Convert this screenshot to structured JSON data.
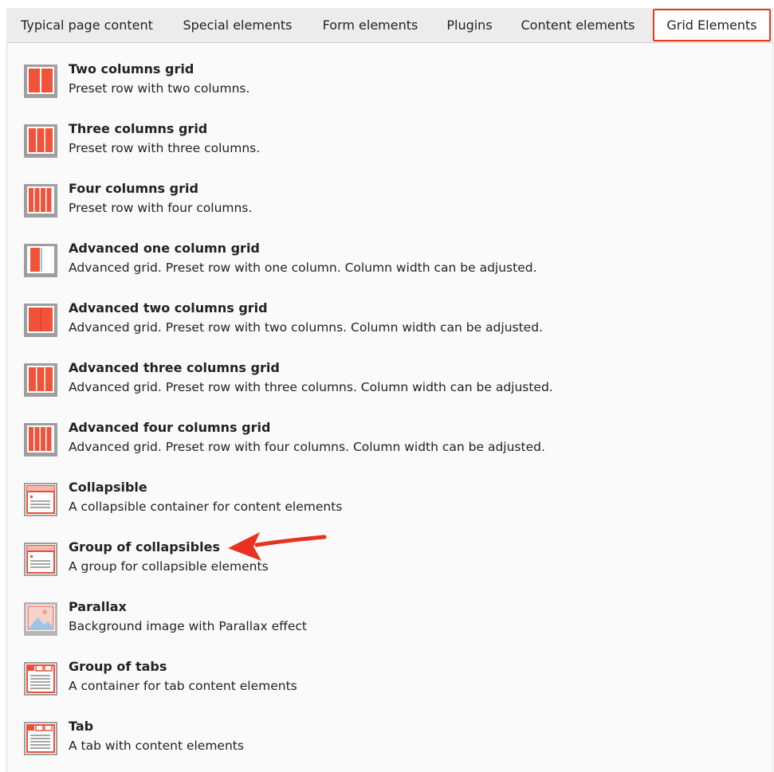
{
  "tabs": [
    {
      "label": "Typical page content"
    },
    {
      "label": "Special elements"
    },
    {
      "label": "Form elements"
    },
    {
      "label": "Plugins"
    },
    {
      "label": "Content elements"
    },
    {
      "label": "Grid Elements"
    }
  ],
  "active_tab": "Grid Elements",
  "colors": {
    "accent": "#e33b23",
    "icon_red": "#f0533a",
    "icon_frame": "#9e9e9e"
  },
  "items": [
    {
      "title": "Two columns grid",
      "description": "Preset row with two columns.",
      "icon": "two-columns-icon"
    },
    {
      "title": "Three columns grid",
      "description": "Preset row with three columns.",
      "icon": "three-columns-icon"
    },
    {
      "title": "Four columns grid",
      "description": "Preset row with four columns.",
      "icon": "four-columns-icon"
    },
    {
      "title": "Advanced one column grid",
      "description": "Advanced grid. Preset row with one column. Column width can be adjusted.",
      "icon": "advanced-one-column-icon"
    },
    {
      "title": "Advanced two columns grid",
      "description": "Advanced grid. Preset row with two columns. Column width can be adjusted.",
      "icon": "advanced-two-columns-icon"
    },
    {
      "title": "Advanced three columns grid",
      "description": "Advanced grid. Preset row with three columns. Column width can be adjusted.",
      "icon": "advanced-three-columns-icon"
    },
    {
      "title": "Advanced four columns grid",
      "description": "Advanced grid. Preset row with four columns. Column width can be adjusted.",
      "icon": "advanced-four-columns-icon"
    },
    {
      "title": "Collapsible",
      "description": "A collapsible container for content elements",
      "icon": "collapsible-icon"
    },
    {
      "title": "Group of collapsibles",
      "description": "A group for collapsible elements",
      "icon": "group-collapsibles-icon"
    },
    {
      "title": "Parallax",
      "description": "Background image with Parallax effect",
      "icon": "parallax-image-icon"
    },
    {
      "title": "Group of tabs",
      "description": "A container for tab content elements",
      "icon": "group-tabs-icon"
    },
    {
      "title": "Tab",
      "description": "A tab with content elements",
      "icon": "tab-icon"
    }
  ]
}
